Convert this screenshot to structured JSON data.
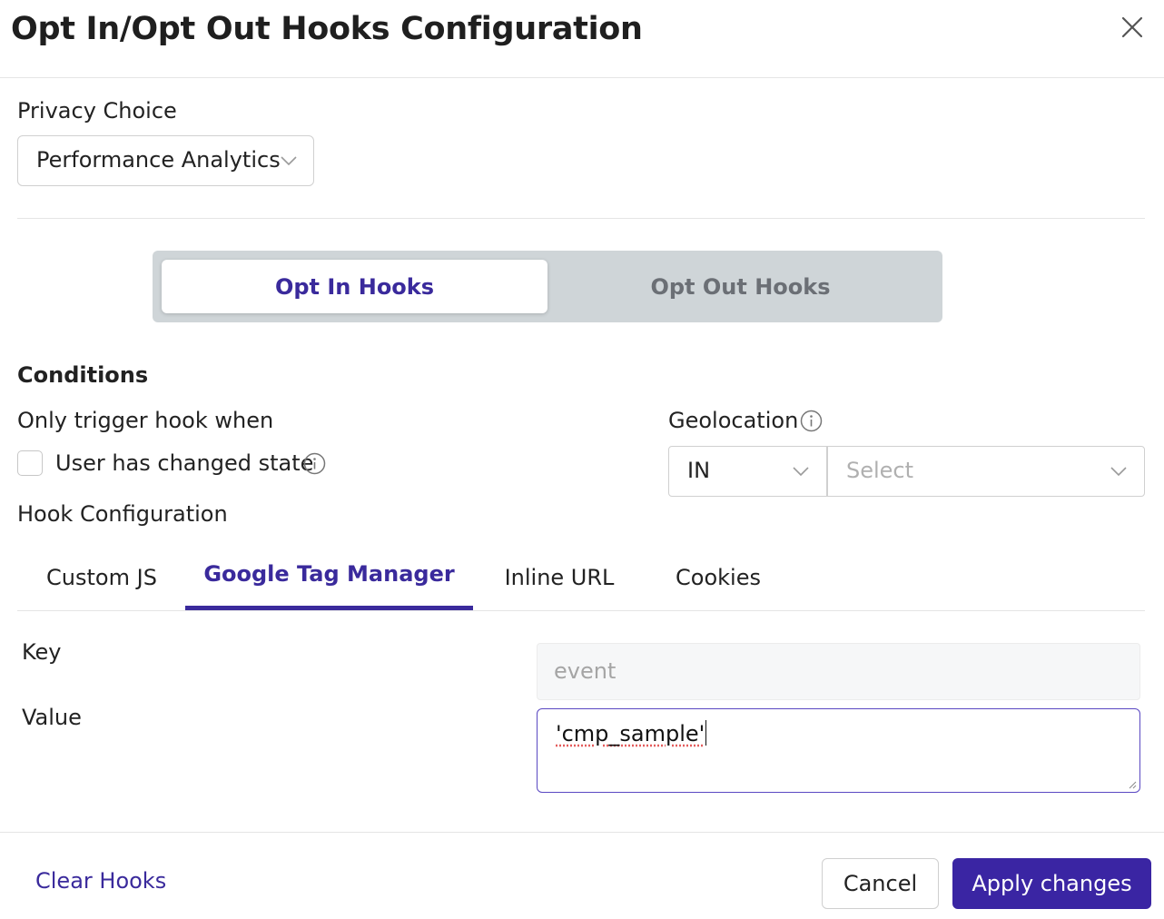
{
  "header": {
    "title": "Opt In/Opt Out Hooks Configuration"
  },
  "privacy_choice": {
    "label": "Privacy Choice",
    "selected": "Performance Analytics"
  },
  "hook_toggle": {
    "options": [
      "Opt In Hooks",
      "Opt Out Hooks"
    ],
    "active": "Opt In Hooks"
  },
  "conditions": {
    "heading": "Conditions",
    "trigger_label": "Only trigger hook when",
    "checkbox_label": "User has changed state",
    "checkbox_checked": false,
    "geolocation": {
      "label": "Geolocation",
      "operator": "IN",
      "region_placeholder": "Select"
    }
  },
  "hook_configuration": {
    "label": "Hook Configuration",
    "tabs": [
      "Custom JS",
      "Google Tag Manager",
      "Inline URL",
      "Cookies"
    ],
    "active_tab": "Google Tag Manager",
    "key_label": "Key",
    "key_value": "event",
    "value_label": "Value",
    "value_value": "'cmp_sample'"
  },
  "footer": {
    "clear_label": "Clear Hooks",
    "cancel_label": "Cancel",
    "apply_label": "Apply changes"
  },
  "colors": {
    "accent": "#3a2a9c",
    "apply_button": "#3a25a3",
    "toggle_track": "#cfd5d8"
  },
  "icons": {
    "close": "close-icon",
    "chevron": "chevron-down-icon",
    "info": "info-icon"
  }
}
